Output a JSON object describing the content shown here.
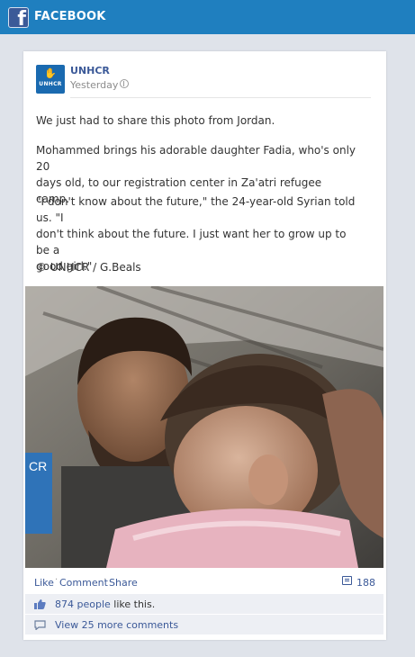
{
  "header": {
    "title": "FACEBOOK",
    "logo_letter": "f"
  },
  "post": {
    "author": "UNHCR",
    "avatar_text": "UNHCR",
    "time": "Yesterday",
    "paragraphs": [
      "We just had to share this photo from Jordan.",
      "Mohammed brings his adorable daughter Fadia, who's only 20\ndays old, to our registration center in Za'atri refugee camp.",
      "\"I don't know about the future,\" the 24-year-old Syrian told us. \"I\ndon't think about the future. I just want her to grow up to be a\ngood girl.\"",
      "© UNHCR / G.Beals"
    ],
    "photo_watermark": "CR"
  },
  "actions": {
    "like": "Like",
    "comment": "Comment",
    "share": "Share",
    "comment_count": "188"
  },
  "likes": {
    "count_text": "874 people",
    "suffix": "like this."
  },
  "more_comments": "View 25 more comments",
  "colors": {
    "header_bg": "#1f7fbf",
    "link": "#3b5998",
    "page_bg": "#dfe3ea",
    "row_bg": "#edeff4"
  }
}
